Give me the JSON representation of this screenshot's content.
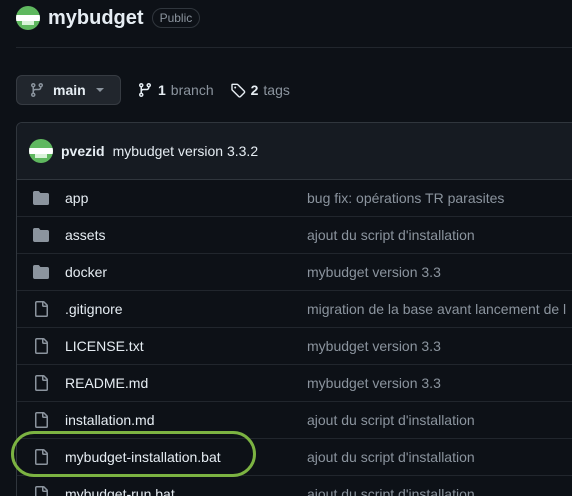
{
  "repo": {
    "name": "mybudget",
    "visibility": "Public"
  },
  "toolbar": {
    "branch_label": "main",
    "branches_count": "1",
    "branches_label": "branch",
    "tags_count": "2",
    "tags_label": "tags"
  },
  "commit": {
    "author": "pvezid",
    "message": "mybudget version 3.3.2"
  },
  "files": [
    {
      "type": "folder",
      "name": "app",
      "commit": "bug fix: opérations TR parasites"
    },
    {
      "type": "folder",
      "name": "assets",
      "commit": "ajout du script d'installation"
    },
    {
      "type": "folder",
      "name": "docker",
      "commit": "mybudget version 3.3"
    },
    {
      "type": "file",
      "name": ".gitignore",
      "commit": "migration de la base avant lancement de l"
    },
    {
      "type": "file",
      "name": "LICENSE.txt",
      "commit": "mybudget version 3.3"
    },
    {
      "type": "file",
      "name": "README.md",
      "commit": "mybudget version 3.3"
    },
    {
      "type": "file",
      "name": "installation.md",
      "commit": "ajout du script d'installation"
    },
    {
      "type": "file",
      "name": "mybudget-installation.bat",
      "commit": "ajout du script d'installation"
    },
    {
      "type": "file",
      "name": "mybudget-run.bat",
      "commit": "ajout du script d'installation"
    }
  ],
  "colors": {
    "background": "#0d1117",
    "highlight": "#7cb342",
    "folder_icon": "#8b949e"
  }
}
